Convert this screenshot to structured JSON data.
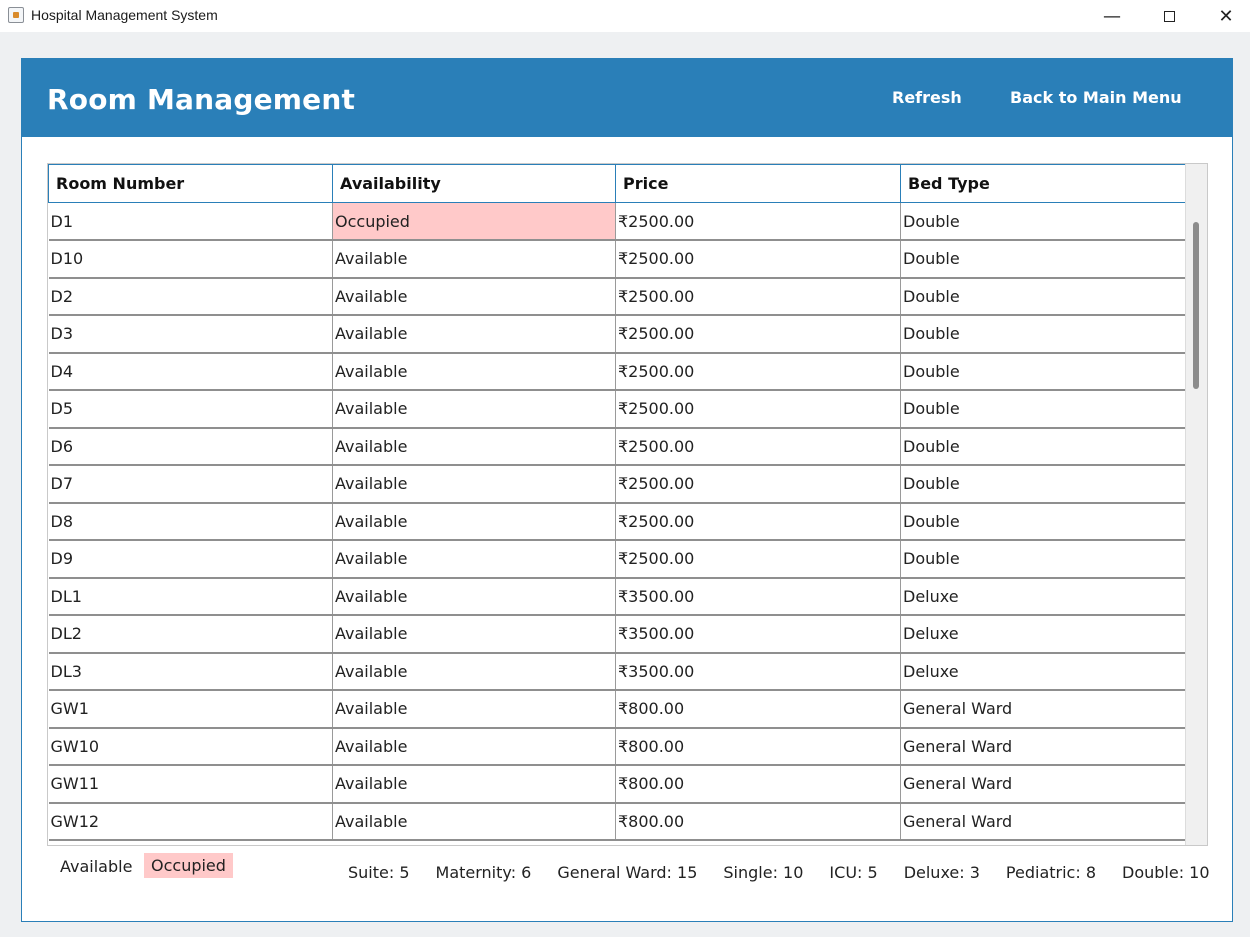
{
  "window": {
    "title": "Hospital Management System",
    "icon": "java-app-icon",
    "controls": {
      "minimize": "—",
      "close": "✕"
    }
  },
  "header": {
    "title": "Room Management",
    "refresh_label": "Refresh",
    "back_label": "Back to Main Menu",
    "color": "#2a7fb8"
  },
  "table": {
    "columns": [
      "Room Number",
      "Availability",
      "Price",
      "Bed Type"
    ],
    "rows": [
      {
        "room": "D1",
        "availability": "Occupied",
        "price": "₹2500.00",
        "bed_type": "Double"
      },
      {
        "room": "D10",
        "availability": "Available",
        "price": "₹2500.00",
        "bed_type": "Double"
      },
      {
        "room": "D2",
        "availability": "Available",
        "price": "₹2500.00",
        "bed_type": "Double"
      },
      {
        "room": "D3",
        "availability": "Available",
        "price": "₹2500.00",
        "bed_type": "Double"
      },
      {
        "room": "D4",
        "availability": "Available",
        "price": "₹2500.00",
        "bed_type": "Double"
      },
      {
        "room": "D5",
        "availability": "Available",
        "price": "₹2500.00",
        "bed_type": "Double"
      },
      {
        "room": "D6",
        "availability": "Available",
        "price": "₹2500.00",
        "bed_type": "Double"
      },
      {
        "room": "D7",
        "availability": "Available",
        "price": "₹2500.00",
        "bed_type": "Double"
      },
      {
        "room": "D8",
        "availability": "Available",
        "price": "₹2500.00",
        "bed_type": "Double"
      },
      {
        "room": "D9",
        "availability": "Available",
        "price": "₹2500.00",
        "bed_type": "Double"
      },
      {
        "room": "DL1",
        "availability": "Available",
        "price": "₹3500.00",
        "bed_type": "Deluxe"
      },
      {
        "room": "DL2",
        "availability": "Available",
        "price": "₹3500.00",
        "bed_type": "Deluxe"
      },
      {
        "room": "DL3",
        "availability": "Available",
        "price": "₹3500.00",
        "bed_type": "Deluxe"
      },
      {
        "room": "GW1",
        "availability": "Available",
        "price": "₹800.00",
        "bed_type": "General Ward"
      },
      {
        "room": "GW10",
        "availability": "Available",
        "price": "₹800.00",
        "bed_type": "General Ward"
      },
      {
        "room": "GW11",
        "availability": "Available",
        "price": "₹800.00",
        "bed_type": "General Ward"
      },
      {
        "room": "GW12",
        "availability": "Available",
        "price": "₹800.00",
        "bed_type": "General Ward"
      }
    ],
    "occupied_color": "#ffc9c9"
  },
  "legend": {
    "available": "Available",
    "occupied": "Occupied"
  },
  "stats": [
    "Suite: 5",
    "Maternity: 6",
    "General Ward: 15",
    "Single: 10",
    "ICU: 5",
    "Deluxe: 3",
    "Pediatric: 8",
    "Double: 10"
  ]
}
